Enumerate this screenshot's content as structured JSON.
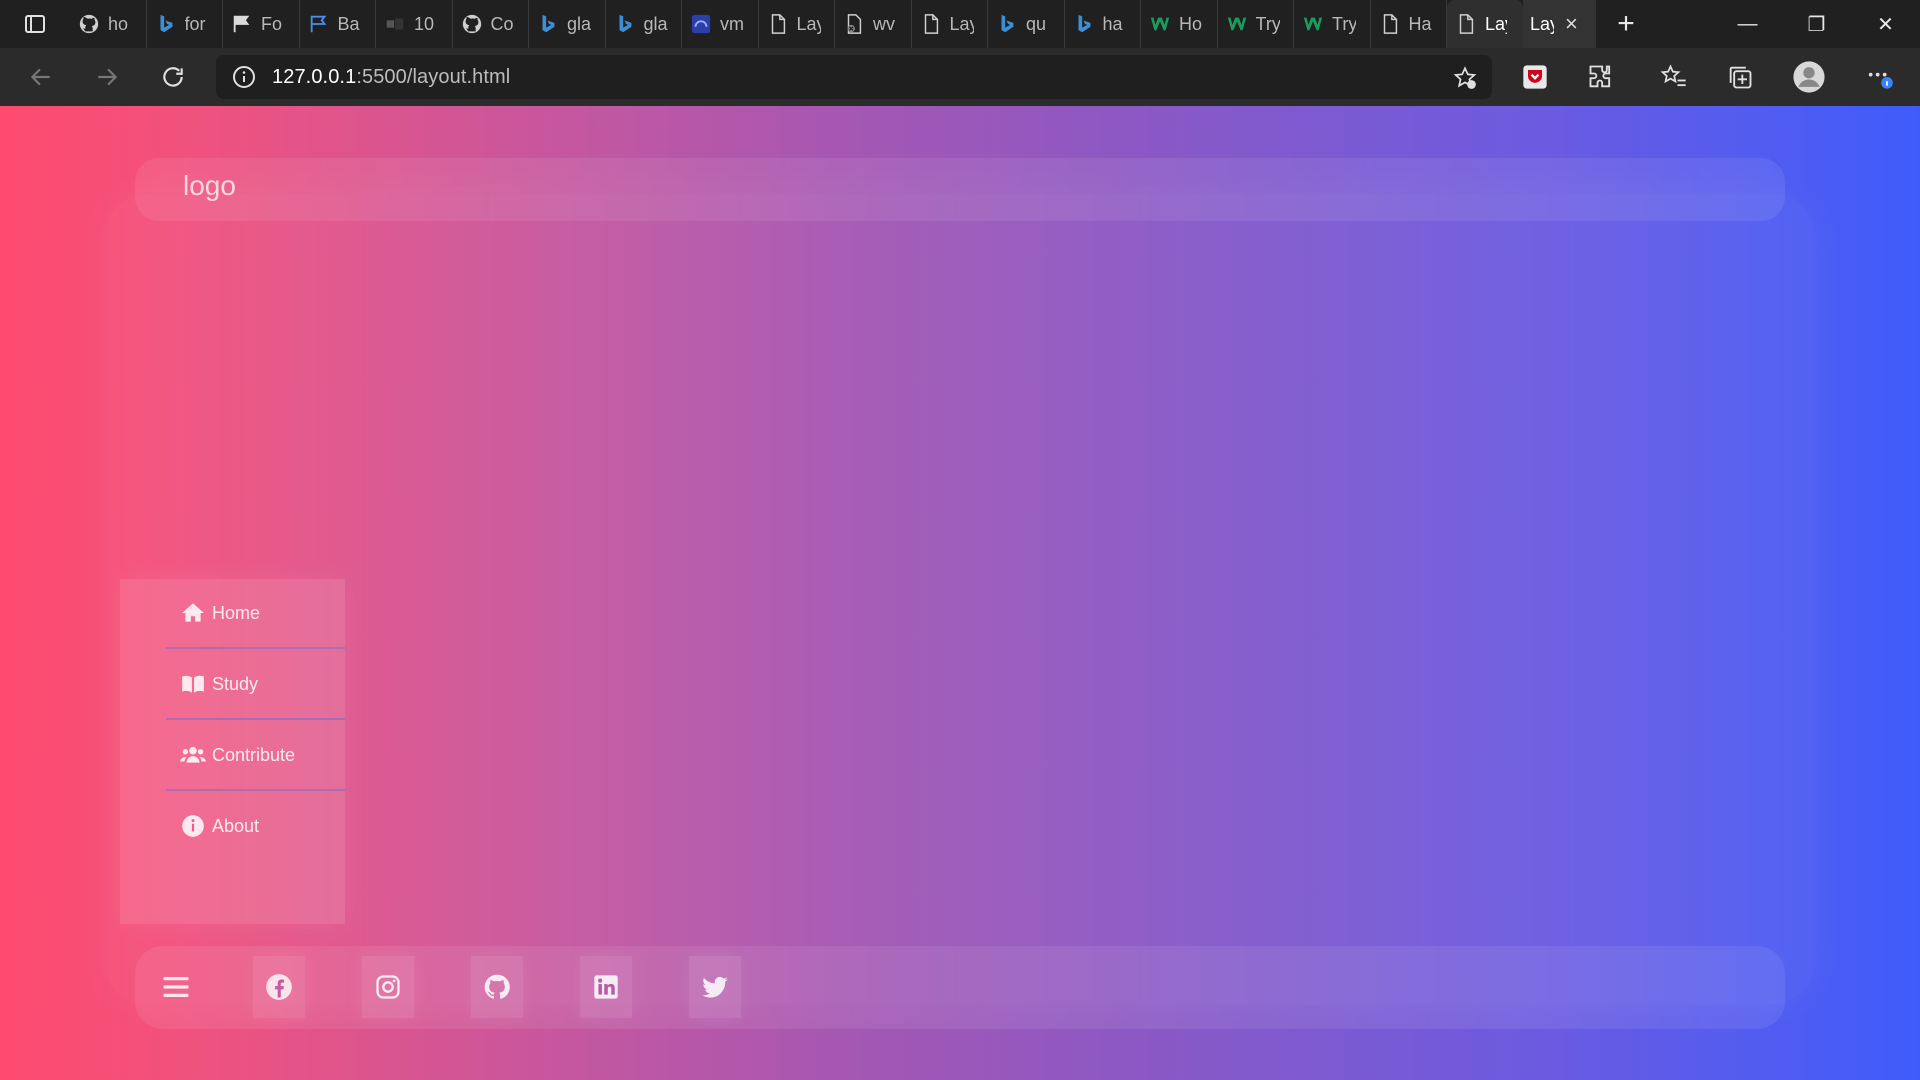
{
  "browser": {
    "tabs": [
      {
        "icon": "github-icon",
        "label": "ho"
      },
      {
        "icon": "bing-icon",
        "label": "for"
      },
      {
        "icon": "flag-icon",
        "label": "Fo"
      },
      {
        "icon": "flag-outline-icon",
        "label": "Ba"
      },
      {
        "icon": "block-icon",
        "label": "10"
      },
      {
        "icon": "github-icon",
        "label": "Co"
      },
      {
        "icon": "bing-icon",
        "label": "gla"
      },
      {
        "icon": "bing-icon",
        "label": "gla"
      },
      {
        "icon": "vm-icon",
        "label": "vm"
      },
      {
        "icon": "page-icon",
        "label": "Lay"
      },
      {
        "icon": "page-broken-icon",
        "label": "wv"
      },
      {
        "icon": "page-icon",
        "label": "Lay"
      },
      {
        "icon": "bing-icon",
        "label": "qu"
      },
      {
        "icon": "bing-icon",
        "label": "ha"
      },
      {
        "icon": "w3schools-icon",
        "label": "Ho"
      },
      {
        "icon": "w3schools-icon",
        "label": "Try"
      },
      {
        "icon": "w3schools-icon",
        "label": "Try"
      },
      {
        "icon": "page-icon",
        "label": "Ha"
      },
      {
        "icon": "page-icon",
        "label": "Lay"
      }
    ],
    "current_tab": {
      "label": "Lay",
      "close": "×"
    },
    "new_tab": "+",
    "window_controls": {
      "minimize": "—",
      "restore": "❐",
      "close": "✕"
    },
    "url_host": "127.0.0.1",
    "url_rest": ":5500/layout.html"
  },
  "page": {
    "logo": "logo",
    "nav": [
      {
        "label": "Home",
        "icon": "home-icon"
      },
      {
        "label": "Study",
        "icon": "book-open-icon"
      },
      {
        "label": "Contribute",
        "icon": "users-icon"
      },
      {
        "label": "About",
        "icon": "info-icon"
      }
    ],
    "footer": {
      "menu_icon": "hamburger-icon",
      "socials": [
        "facebook-icon",
        "instagram-icon",
        "github-icon",
        "linkedin-icon",
        "twitter-icon"
      ]
    }
  },
  "colors": {
    "gradient_start": "#fe4a6e",
    "gradient_end": "#3f5cfb"
  }
}
